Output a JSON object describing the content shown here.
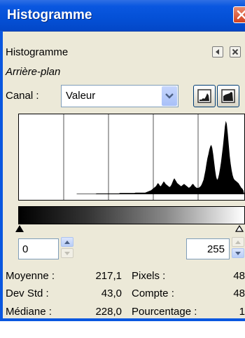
{
  "window": {
    "title": "Histogramme"
  },
  "dialog": {
    "heading": "Histogramme",
    "layer_name": "Arrière-plan",
    "channel_label": "Canal :",
    "channel_value": "Valeur"
  },
  "range": {
    "low": "0",
    "high": "255"
  },
  "stats": {
    "mean_label": "Moyenne :",
    "mean_value": "217,1",
    "std_label": "Dev Std :",
    "std_value": "43,0",
    "median_label": "Médiane :",
    "median_value": "228,0",
    "pixels_label": "Pixels :",
    "pixels_value": "48",
    "count_label": "Compte :",
    "count_value": "48",
    "percent_label": "Pourcentage :",
    "percent_value": "1"
  },
  "icons": {
    "close": "close-icon",
    "restore": "tab-menu-icon",
    "panel_close": "close-icon",
    "dropdown": "chevron-down-icon",
    "linear": "linear-histogram-icon",
    "log": "logarithmic-histogram-icon",
    "spin_up": "arrow-up-icon",
    "spin_down": "arrow-down-icon"
  },
  "colors": {
    "title_bar": "#0450d6",
    "panel_bg": "#ece9d8",
    "histogram_fill": "#000000"
  },
  "histogram": {
    "bins": [
      0,
      0,
      0,
      0,
      0,
      0,
      0,
      0,
      0,
      0,
      0,
      0,
      0,
      0,
      0,
      0,
      0,
      0,
      0,
      0,
      0,
      0,
      0,
      0,
      0,
      0,
      0,
      0,
      0,
      0,
      0,
      0,
      0,
      0,
      0,
      0,
      0,
      0,
      0,
      0,
      0,
      0,
      0,
      0,
      0,
      0,
      0,
      0,
      0,
      0,
      0,
      0,
      0,
      0,
      0,
      0,
      0,
      0,
      0,
      0,
      0.5,
      0.5,
      0.5,
      0.5,
      0.5,
      0.5,
      0.5,
      0.5,
      0.5,
      0.5,
      0.5,
      0.5,
      0.5,
      0.5,
      0.5,
      0.5,
      0.5,
      0.5,
      0.5,
      0.5,
      1,
      1,
      1,
      1,
      1,
      1,
      1,
      1,
      1,
      1,
      1,
      1,
      1,
      1,
      1,
      1,
      1,
      1,
      1,
      1,
      1,
      1,
      1,
      1,
      1.5,
      1.5,
      1.5,
      1.5,
      1.5,
      1.5,
      1.5,
      1.5,
      1.5,
      1.5,
      1.5,
      1.5,
      1.5,
      1.5,
      1.5,
      1.5,
      2,
      2,
      2,
      2,
      2,
      2,
      2,
      2,
      2,
      2,
      2,
      2.5,
      3,
      3.5,
      4,
      4.5,
      5,
      6,
      7,
      8,
      9,
      10,
      12,
      14,
      13,
      11,
      10,
      12,
      14,
      16,
      15,
      13,
      12,
      11,
      10,
      9,
      10,
      12,
      15,
      18,
      20,
      18,
      16,
      14,
      13,
      12,
      11,
      10,
      11,
      12,
      13,
      12,
      11,
      10,
      9,
      8,
      9,
      10,
      12,
      13,
      12,
      10,
      9,
      8,
      8,
      8,
      9,
      10,
      12,
      15,
      18,
      24,
      30,
      38,
      45,
      50,
      56,
      60,
      62,
      58,
      50,
      40,
      30,
      22,
      18,
      20,
      25,
      32,
      40,
      50,
      60,
      72,
      85,
      92,
      88,
      76,
      62,
      48,
      38,
      30,
      24,
      20,
      18,
      17,
      16,
      15,
      14,
      12,
      10,
      8,
      7,
      5
    ],
    "max": 95
  }
}
